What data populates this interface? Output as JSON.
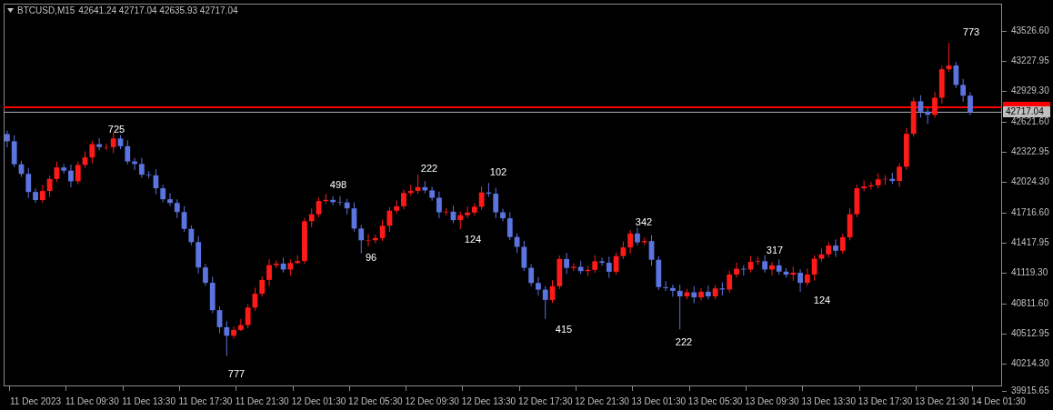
{
  "header": {
    "symbol": "BTCUSD,M15",
    "ohlc": "42641.24 42717.04 42635.93 42717.04"
  },
  "chart": {
    "chart_data": {
      "type": "candlestick",
      "ref_lines": [
        {
          "axis": "y",
          "value": 42767,
          "color": "#ff0000"
        },
        {
          "axis": "y",
          "value": 42717.04,
          "color": "#b0b0b0",
          "label": "42717.04"
        }
      ],
      "ylim": [
        39988,
        43798
      ],
      "yticks": [
        {
          "value": 43526.6,
          "label": "43526.60"
        },
        {
          "value": 43227.95,
          "label": "43227.95"
        },
        {
          "value": 42929.3,
          "label": "42929.30"
        },
        {
          "value": 42621.6,
          "label": "42621.60"
        },
        {
          "value": 42322.95,
          "label": "42322.95"
        },
        {
          "value": 42024.3,
          "label": "42024.30"
        },
        {
          "value": 41716.6,
          "label": "41716.60"
        },
        {
          "value": 41417.95,
          "label": "41417.95"
        },
        {
          "value": 41119.3,
          "label": "41119.30"
        },
        {
          "value": 40811.6,
          "label": "40811.60"
        },
        {
          "value": 40512.95,
          "label": "40512.95"
        },
        {
          "value": 40214.3,
          "label": "40214.30"
        }
      ],
      "categories": [
        null,
        null,
        null,
        null,
        "11 Dec 2023",
        null,
        null,
        null,
        null,
        null,
        null,
        null,
        "11 Dec 09:30",
        null,
        null,
        null,
        null,
        null,
        null,
        null,
        "11 Dec 13:30",
        null,
        null,
        null,
        null,
        null,
        null,
        null,
        "11 Dec 17:30",
        null,
        null,
        null,
        null,
        null,
        null,
        null,
        "11 Dec 21:30",
        null,
        null,
        null,
        null,
        null,
        null,
        null,
        "12 Dec 01:30",
        null,
        null,
        null,
        null,
        null,
        null,
        null,
        "12 Dec 05:30",
        null,
        null,
        null,
        null,
        null,
        null,
        null,
        "12 Dec 09:30",
        null,
        null,
        null,
        null,
        null,
        null,
        null,
        "12 Dec 13:30",
        null,
        null,
        null,
        null,
        null,
        null,
        null,
        "12 Dec 17:30",
        null,
        null,
        null,
        null,
        null,
        null,
        null,
        "12 Dec 21:30",
        null,
        null,
        null,
        null,
        null,
        null,
        null,
        "13 Dec 01:30",
        null,
        null,
        null,
        null,
        null,
        null,
        null,
        "13 Dec 05:30",
        null,
        null,
        null,
        null,
        null,
        null,
        null,
        "13 Dec 09:30",
        null,
        null,
        null,
        null,
        null,
        null,
        null,
        "13 Dec 13:30",
        null,
        null,
        null,
        null,
        null,
        null,
        null,
        "13 Dec 17:30",
        null,
        null,
        null,
        null,
        null,
        null,
        null,
        "13 Dec 21:30",
        null,
        null,
        null,
        null,
        null,
        null,
        null,
        "14 Dec 01:30"
      ],
      "ohlc": [
        [
          42500,
          42535,
          42368,
          42428
        ],
        [
          42428,
          42488,
          42169,
          42199
        ],
        [
          42199,
          42234,
          42073,
          42103
        ],
        [
          42103,
          42163,
          41863,
          41923
        ],
        [
          41923,
          41958,
          41813,
          41843
        ],
        [
          41843,
          41993,
          41813,
          41933
        ],
        [
          41933,
          42088,
          41873,
          42053
        ],
        [
          42053,
          42227,
          42023,
          42167
        ],
        [
          42167,
          42202,
          42106,
          42136
        ],
        [
          42136,
          42196,
          41970,
          42030
        ],
        [
          42030,
          42228,
          42000,
          42193
        ],
        [
          42193,
          42327,
          42163,
          42267
        ],
        [
          42267,
          42434,
          42207,
          42399
        ],
        [
          42399,
          42459,
          42340,
          42370
        ],
        [
          42370,
          42405,
          42340,
          42370
        ],
        [
          42370,
          42516,
          42310,
          42456
        ],
        [
          42456,
          42491,
          42349,
          42379
        ],
        [
          42379,
          42439,
          42197,
          42227
        ],
        [
          42227,
          42262,
          42142,
          42202
        ],
        [
          42202,
          42262,
          42065,
          42095
        ],
        [
          42095,
          42130,
          42059,
          42089
        ],
        [
          42089,
          42149,
          41900,
          41960
        ],
        [
          41960,
          41995,
          41821,
          41851
        ],
        [
          41851,
          41911,
          41784,
          41814
        ],
        [
          41814,
          41849,
          41663,
          41723
        ],
        [
          41723,
          41783,
          41526,
          41556
        ],
        [
          41556,
          41591,
          41394,
          41424
        ],
        [
          41424,
          41484,
          41112,
          41172
        ],
        [
          41172,
          41207,
          40989,
          41019
        ],
        [
          41019,
          41079,
          40717,
          40747
        ],
        [
          40747,
          40782,
          40517,
          40577
        ],
        [
          40577,
          40637,
          40292,
          40492
        ],
        [
          40492,
          40585,
          40462,
          40550
        ],
        [
          40550,
          40658,
          40538,
          40598
        ],
        [
          40598,
          40807,
          40568,
          40772
        ],
        [
          40772,
          40970,
          40742,
          40910
        ],
        [
          40910,
          41083,
          40880,
          41048
        ],
        [
          41048,
          41255,
          40988,
          41195
        ],
        [
          41195,
          41245,
          41165,
          41210
        ],
        [
          41210,
          41270,
          41121,
          41151
        ],
        [
          41151,
          41251,
          41091,
          41216
        ],
        [
          41216,
          41295,
          41205,
          41235
        ],
        [
          41235,
          41667,
          41205,
          41632
        ],
        [
          41632,
          41761,
          41572,
          41701
        ],
        [
          41701,
          41868,
          41671,
          41833
        ],
        [
          41833,
          41905,
          41803,
          41845
        ],
        [
          41845,
          41880,
          41792,
          41822
        ],
        [
          41822,
          41882,
          41789,
          41819
        ],
        [
          41819,
          41854,
          41700,
          41760
        ],
        [
          41760,
          41820,
          41529,
          41559
        ],
        [
          41559,
          41594,
          41312,
          41442
        ],
        [
          41442,
          41503,
          41383,
          41443
        ],
        [
          41443,
          41499,
          41413,
          41464
        ],
        [
          41464,
          41647,
          41434,
          41587
        ],
        [
          41587,
          41772,
          41527,
          41737
        ],
        [
          41737,
          41841,
          41707,
          41781
        ],
        [
          41781,
          41948,
          41751,
          41913
        ],
        [
          41913,
          41994,
          41883,
          41934
        ],
        [
          41934,
          42096,
          41904,
          41971
        ],
        [
          41971,
          42031,
          41909,
          41939
        ],
        [
          41939,
          41974,
          41836,
          41866
        ],
        [
          41866,
          41926,
          41661,
          41721
        ],
        [
          41721,
          41762,
          41691,
          41727
        ],
        [
          41727,
          41787,
          41613,
          41643
        ],
        [
          41643,
          41727,
          41553,
          41692
        ],
        [
          41692,
          41779,
          41662,
          41719
        ],
        [
          41719,
          41811,
          41689,
          41776
        ],
        [
          41776,
          41978,
          41746,
          41918
        ],
        [
          41918,
          42013,
          41876,
          41906
        ],
        [
          41906,
          41966,
          41661,
          41721
        ],
        [
          41721,
          41756,
          41631,
          41661
        ],
        [
          41661,
          41721,
          41445,
          41475
        ],
        [
          41475,
          41510,
          41317,
          41377
        ],
        [
          41377,
          41437,
          41138,
          41168
        ],
        [
          41168,
          41203,
          40987,
          41017
        ],
        [
          41017,
          41077,
          40891,
          40951
        ],
        [
          40951,
          40986,
          40660,
          40849
        ],
        [
          40849,
          41045,
          40819,
          40985
        ],
        [
          40985,
          41291,
          40955,
          41256
        ],
        [
          41256,
          41316,
          41107,
          41167
        ],
        [
          41167,
          41213,
          41137,
          41178
        ],
        [
          41178,
          41238,
          41106,
          41136
        ],
        [
          41136,
          41183,
          41088,
          41148
        ],
        [
          41148,
          41293,
          41118,
          41233
        ],
        [
          41233,
          41268,
          41188,
          41218
        ],
        [
          41218,
          41278,
          41069,
          41129
        ],
        [
          41129,
          41320,
          41099,
          41285
        ],
        [
          41285,
          41431,
          41255,
          41371
        ],
        [
          41371,
          41545,
          41311,
          41510
        ],
        [
          41510,
          41570,
          41392,
          41422
        ],
        [
          41422,
          41469,
          41392,
          41434
        ],
        [
          41434,
          41494,
          41188,
          41248
        ],
        [
          41248,
          41283,
          40946,
          40976
        ],
        [
          40976,
          41036,
          40937,
          40967
        ],
        [
          40967,
          41002,
          40879,
          40939
        ],
        [
          40939,
          40999,
          40555,
          40884
        ],
        [
          40884,
          40959,
          40854,
          40924
        ],
        [
          40924,
          40984,
          40814,
          40874
        ],
        [
          40874,
          40965,
          40844,
          40930
        ],
        [
          40930,
          40990,
          40854,
          40884
        ],
        [
          40884,
          40998,
          40854,
          40963
        ],
        [
          40963,
          41023,
          40892,
          40952
        ],
        [
          40952,
          41136,
          40922,
          41101
        ],
        [
          41101,
          41219,
          41071,
          41159
        ],
        [
          41159,
          41194,
          41091,
          41151
        ],
        [
          41151,
          41287,
          41121,
          41227
        ],
        [
          41227,
          41279,
          41197,
          41234
        ],
        [
          41234,
          41294,
          41121,
          41151
        ],
        [
          41151,
          41228,
          41091,
          41193
        ],
        [
          41193,
          41253,
          41100,
          41130
        ],
        [
          41130,
          41165,
          41070,
          41100
        ],
        [
          41100,
          41179,
          41040,
          41119
        ],
        [
          41119,
          41154,
          40929,
          41019
        ],
        [
          41019,
          41161,
          40989,
          41101
        ],
        [
          41101,
          41294,
          41041,
          41259
        ],
        [
          41259,
          41362,
          41229,
          41302
        ],
        [
          41302,
          41425,
          41272,
          41390
        ],
        [
          41390,
          41450,
          41278,
          41338
        ],
        [
          41338,
          41507,
          41308,
          41472
        ],
        [
          41472,
          41762,
          41442,
          41702
        ],
        [
          41702,
          41995,
          41672,
          41960
        ],
        [
          41960,
          42038,
          41930,
          41978
        ],
        [
          41978,
          42024,
          41948,
          41989
        ],
        [
          41989,
          42109,
          41959,
          42049
        ],
        [
          42049,
          42089,
          41994,
          42054
        ],
        [
          42054,
          42114,
          42003,
          42033
        ],
        [
          42033,
          42210,
          41973,
          42175
        ],
        [
          42175,
          42562,
          42145,
          42502
        ],
        [
          42502,
          42861,
          42472,
          42826
        ],
        [
          42826,
          42886,
          42663,
          42723
        ],
        [
          42723,
          42758,
          42602,
          42692
        ],
        [
          42692,
          42921,
          42662,
          42861
        ],
        [
          42861,
          43180,
          42801,
          43145
        ],
        [
          43145,
          43406,
          43115,
          43182
        ],
        [
          43182,
          43217,
          42959,
          42989
        ],
        [
          42989,
          43049,
          42822,
          42882
        ],
        [
          42882,
          42917,
          42687,
          42717
        ],
        null,
        null,
        null,
        null
      ]
    },
    "bottom_price_label": "39915.65",
    "swing_labels": [
      {
        "text": "725"
      },
      {
        "text": "777"
      },
      {
        "text": "498"
      },
      {
        "text": "96"
      },
      {
        "text": "222"
      },
      {
        "text": "124"
      },
      {
        "text": "102"
      },
      {
        "text": "415"
      },
      {
        "text": "342"
      },
      {
        "text": "222"
      },
      {
        "text": "317"
      },
      {
        "text": "124"
      },
      {
        "text": "773"
      }
    ]
  }
}
